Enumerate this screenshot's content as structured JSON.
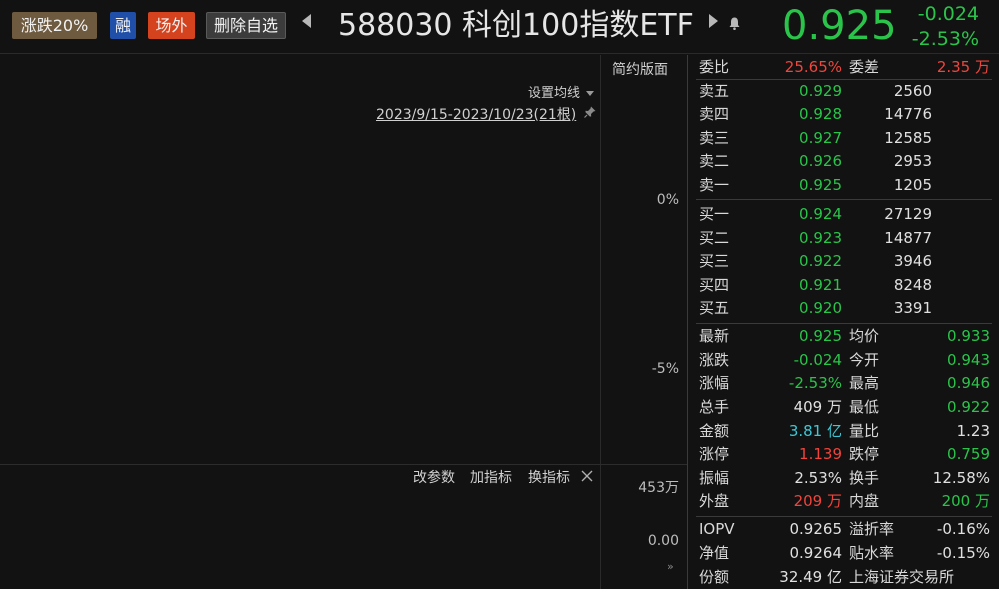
{
  "header": {
    "tags": {
      "limit": "涨跌20%",
      "margin": "融",
      "otc": "场外",
      "remove": "删除自选"
    },
    "title": "588030 科创100指数ETF",
    "price": "0.925",
    "change": "-0.024",
    "change_pct": "-2.53%"
  },
  "chart": {
    "simple_label": "简约版面",
    "ma_setting": "设置均线",
    "date_range": "2023/9/15-2023/10/23(21根)",
    "y_labels": [
      "0%",
      "-5%"
    ],
    "volume_labels": [
      "453万",
      "0.00"
    ],
    "indicator_buttons": [
      "改参数",
      "加指标",
      "换指标"
    ],
    "scroll_label": "»"
  },
  "quote": {
    "ratio": {
      "label": "委比",
      "value": "25.65%",
      "label2": "委差",
      "value2": "2.35 万"
    },
    "asks": [
      {
        "label": "卖五",
        "price": "0.929",
        "volume": "2560"
      },
      {
        "label": "卖四",
        "price": "0.928",
        "volume": "14776"
      },
      {
        "label": "卖三",
        "price": "0.927",
        "volume": "12585"
      },
      {
        "label": "卖二",
        "price": "0.926",
        "volume": "2953"
      },
      {
        "label": "卖一",
        "price": "0.925",
        "volume": "1205"
      }
    ],
    "bids": [
      {
        "label": "买一",
        "price": "0.924",
        "volume": "27129"
      },
      {
        "label": "买二",
        "price": "0.923",
        "volume": "14877"
      },
      {
        "label": "买三",
        "price": "0.922",
        "volume": "3946"
      },
      {
        "label": "买四",
        "price": "0.921",
        "volume": "8248"
      },
      {
        "label": "买五",
        "price": "0.920",
        "volume": "3391"
      }
    ],
    "stats": [
      {
        "l1": "最新",
        "v1": "0.925",
        "l2": "均价",
        "v2": "0.933"
      },
      {
        "l1": "涨跌",
        "v1": "-0.024",
        "l2": "今开",
        "v2": "0.943"
      },
      {
        "l1": "涨幅",
        "v1": "-2.53%",
        "l2": "最高",
        "v2": "0.946"
      },
      {
        "l1": "总手",
        "v1": "409 万",
        "l2": "最低",
        "v2": "0.922"
      },
      {
        "l1": "金额",
        "v1": "3.81 亿",
        "l2": "量比",
        "v2": "1.23"
      },
      {
        "l1": "涨停",
        "v1": "1.139",
        "l2": "跌停",
        "v2": "0.759"
      },
      {
        "l1": "振幅",
        "v1": "2.53%",
        "l2": "换手",
        "v2": "12.58%"
      },
      {
        "l1": "外盘",
        "v1": "209 万",
        "l2": "内盘",
        "v2": "200 万"
      },
      {
        "l1": "IOPV",
        "v1": "0.9265",
        "l2": "溢折率",
        "v2": "-0.16%"
      },
      {
        "l1": "净值",
        "v1": "0.9264",
        "l2": "贴水率",
        "v2": "-0.15%"
      },
      {
        "l1": "份额",
        "v1": "32.49 亿",
        "l2": "上海证券交易所",
        "v2": ""
      }
    ]
  },
  "colors": {
    "up": "#f0443c",
    "down": "#2bc44a",
    "neutral": "#e0e0e0",
    "money": "#3cc8d8"
  }
}
